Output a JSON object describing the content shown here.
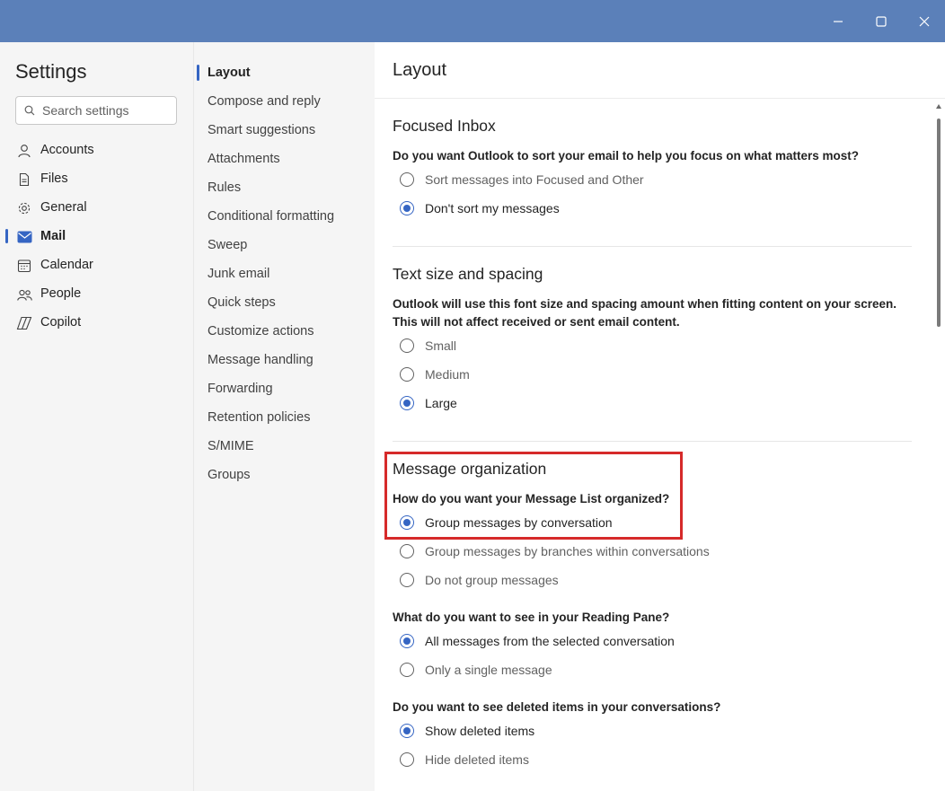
{
  "window": {
    "controls": {
      "minimize": "minimize-icon",
      "maximize": "maximize-icon",
      "close": "close-icon"
    },
    "titlebar_color": "#5b80b9"
  },
  "sidebar": {
    "title": "Settings",
    "search_placeholder": "Search settings",
    "items": [
      {
        "label": "Accounts",
        "icon": "person-icon",
        "active": false
      },
      {
        "label": "Files",
        "icon": "file-icon",
        "active": false
      },
      {
        "label": "General",
        "icon": "gear-icon",
        "active": false
      },
      {
        "label": "Mail",
        "icon": "mail-icon",
        "active": true
      },
      {
        "label": "Calendar",
        "icon": "calendar-icon",
        "active": false
      },
      {
        "label": "People",
        "icon": "people-icon",
        "active": false
      },
      {
        "label": "Copilot",
        "icon": "copilot-icon",
        "active": false
      }
    ]
  },
  "submenu": {
    "items": [
      {
        "label": "Layout",
        "active": true
      },
      {
        "label": "Compose and reply"
      },
      {
        "label": "Smart suggestions"
      },
      {
        "label": "Attachments"
      },
      {
        "label": "Rules"
      },
      {
        "label": "Conditional formatting"
      },
      {
        "label": "Sweep"
      },
      {
        "label": "Junk email"
      },
      {
        "label": "Quick steps"
      },
      {
        "label": "Customize actions"
      },
      {
        "label": "Message handling"
      },
      {
        "label": "Forwarding"
      },
      {
        "label": "Retention policies"
      },
      {
        "label": "S/MIME"
      },
      {
        "label": "Groups"
      }
    ]
  },
  "main": {
    "title": "Layout",
    "focused_inbox": {
      "title": "Focused Inbox",
      "question": "Do you want Outlook to sort your email to help you focus on what matters most?",
      "options": [
        {
          "label": "Sort messages into Focused and Other",
          "selected": false
        },
        {
          "label": "Don't sort my messages",
          "selected": true
        }
      ]
    },
    "text_size": {
      "title": "Text size and spacing",
      "question_line1": "Outlook will use this font size and spacing amount when fitting content on your screen.",
      "question_line2": "This will not affect received or sent email content.",
      "options": [
        {
          "label": "Small",
          "selected": false
        },
        {
          "label": "Medium",
          "selected": false
        },
        {
          "label": "Large",
          "selected": true
        }
      ]
    },
    "message_org": {
      "title": "Message organization",
      "question": "How do you want your Message List organized?",
      "options": [
        {
          "label": "Group messages by conversation",
          "selected": true
        },
        {
          "label": "Group messages by branches within conversations",
          "selected": false
        },
        {
          "label": "Do not group messages",
          "selected": false
        }
      ],
      "reading_question": "What do you want to see in your Reading Pane?",
      "reading_options": [
        {
          "label": "All messages from the selected conversation",
          "selected": true
        },
        {
          "label": "Only a single message",
          "selected": false
        }
      ],
      "deleted_question": "Do you want to see deleted items in your conversations?",
      "deleted_options": [
        {
          "label": "Show deleted items",
          "selected": true
        },
        {
          "label": "Hide deleted items",
          "selected": false
        }
      ]
    }
  },
  "colors": {
    "accent": "#3565c3",
    "highlight_box": "#d62a2a"
  }
}
